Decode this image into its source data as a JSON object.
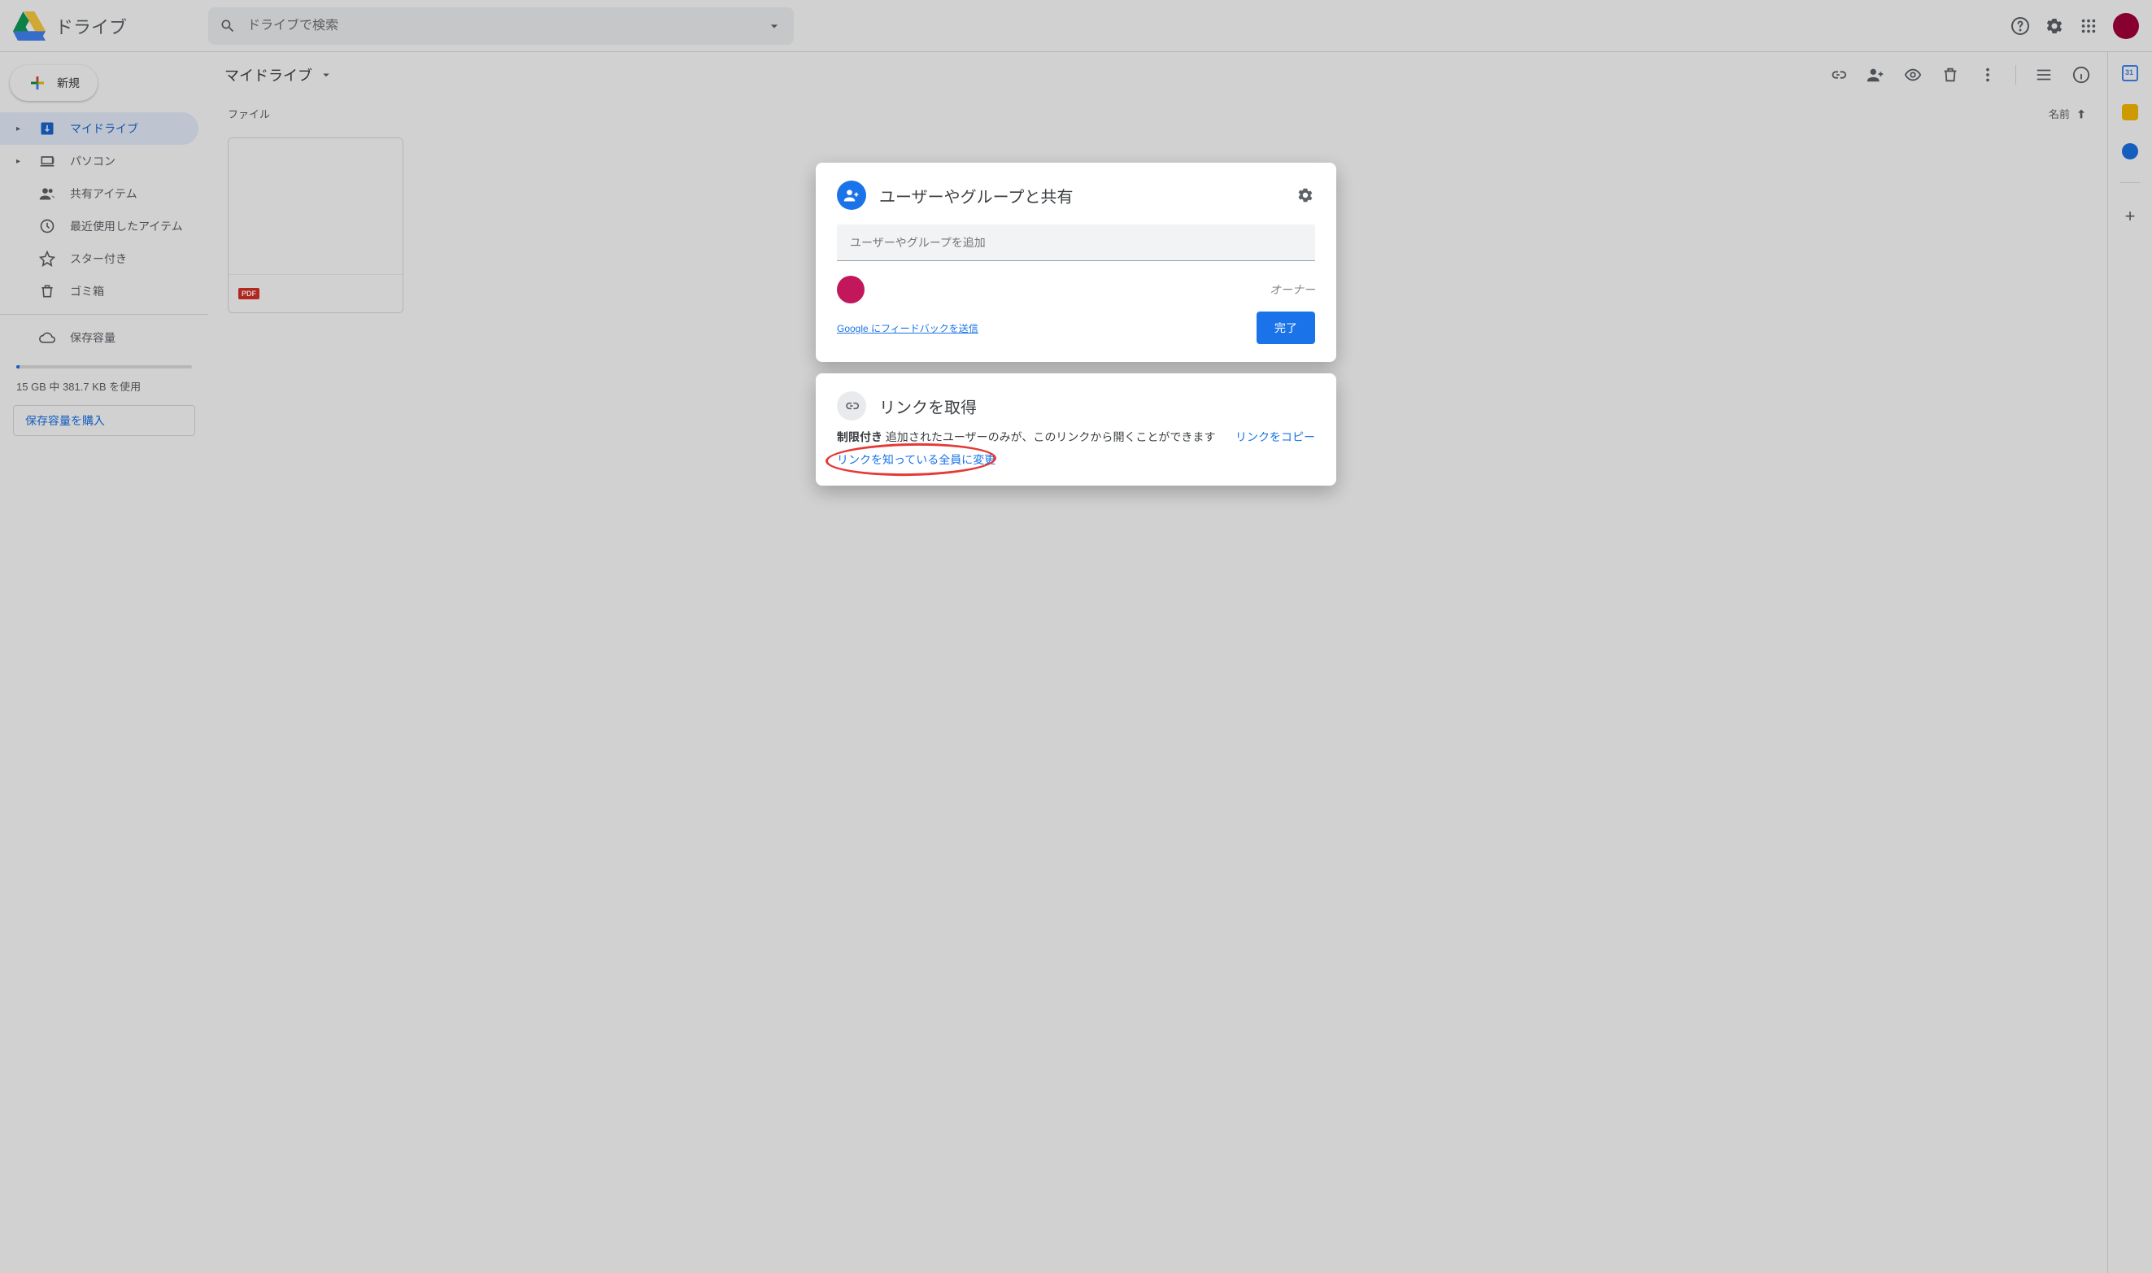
{
  "brand": {
    "name": "ドライブ"
  },
  "search": {
    "placeholder": "ドライブで検索"
  },
  "sidebar": {
    "new_label": "新規",
    "items": [
      {
        "label": "マイドライブ"
      },
      {
        "label": "パソコン"
      },
      {
        "label": "共有アイテム"
      },
      {
        "label": "最近使用したアイテム"
      },
      {
        "label": "スター付き"
      },
      {
        "label": "ゴミ箱"
      }
    ],
    "storage_item_label": "保存容量",
    "storage_text": "15 GB 中 381.7 KB を使用",
    "buy_label": "保存容量を購入"
  },
  "main": {
    "breadcrumb": "マイドライブ",
    "section_label": "ファイル",
    "sort_label": "名前",
    "file_badge": "PDF"
  },
  "share_dialog": {
    "title": "ユーザーやグループと共有",
    "input_placeholder": "ユーザーやグループを追加",
    "owner_label": "オーナー",
    "feedback_label": "Google にフィードバックを送信",
    "done_label": "完了"
  },
  "link_dialog": {
    "title": "リンクを取得",
    "restricted_label": "制限付き",
    "restricted_desc": "追加されたユーザーのみが、このリンクから開くことができます",
    "copy_label": "リンクをコピー",
    "change_label": "リンクを知っている全員に変更"
  },
  "rightrail": {
    "calendar_day": "31"
  }
}
